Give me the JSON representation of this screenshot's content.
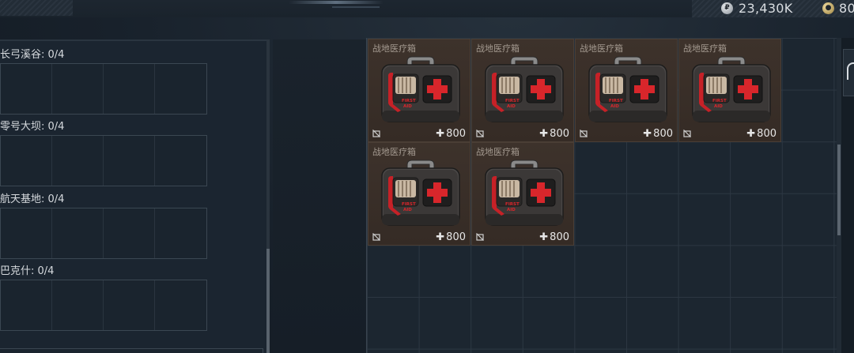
{
  "currency": {
    "silver_amount": "23,430K",
    "gold_amount": "80"
  },
  "maps": [
    {
      "label": "长弓溪谷: 0/4"
    },
    {
      "label": "零号大坝: 0/4"
    },
    {
      "label": "航天基地: 0/4"
    },
    {
      "label": "巴克什: 0/4"
    }
  ],
  "items": [
    {
      "name": "战地医疗箱",
      "quantity": "800"
    },
    {
      "name": "战地医疗箱",
      "quantity": "800"
    },
    {
      "name": "战地医疗箱",
      "quantity": "800"
    },
    {
      "name": "战地医疗箱",
      "quantity": "800"
    },
    {
      "name": "战地医疗箱",
      "quantity": "800"
    },
    {
      "name": "战地医疗箱",
      "quantity": "800"
    }
  ],
  "icons": {
    "silver": "silver-coin-icon",
    "gold": "gold-coin-icon",
    "item_lock": "no-trade-icon",
    "item_art": "first-aid-kit-icon",
    "side": "side-tab-icon"
  },
  "colors": {
    "item_bg": "#3d322b",
    "kit_red": "#d8262b"
  }
}
